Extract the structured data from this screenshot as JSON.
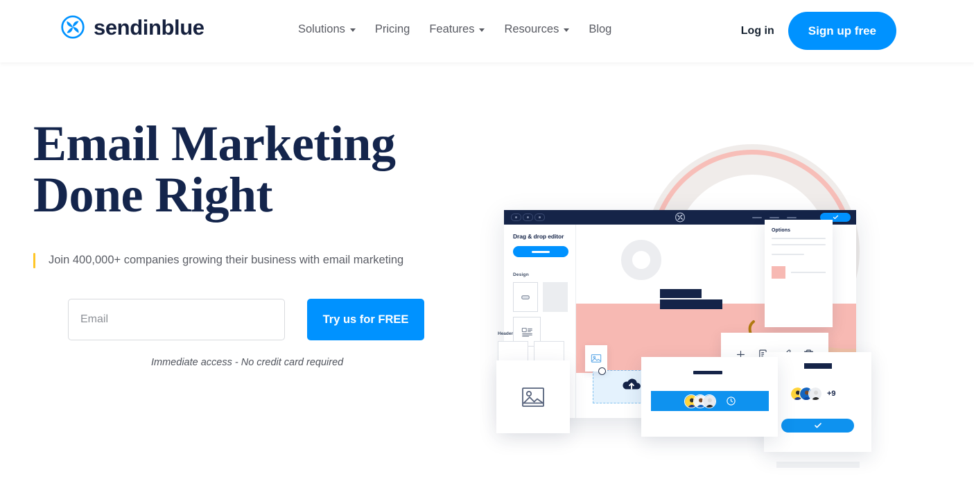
{
  "header": {
    "brand_name": "sendinblue",
    "logo_icon": "sendinblue-pinwheel-icon",
    "nav": [
      {
        "label": "Solutions",
        "has_dropdown": true
      },
      {
        "label": "Pricing",
        "has_dropdown": false
      },
      {
        "label": "Features",
        "has_dropdown": true
      },
      {
        "label": "Resources",
        "has_dropdown": true
      },
      {
        "label": "Blog",
        "has_dropdown": false
      }
    ],
    "login_label": "Log in",
    "signup_label": "Sign up free"
  },
  "hero": {
    "title": "Email Marketing Done Right",
    "subtitle": "Join 400,000+ companies growing their business with email marketing",
    "email_placeholder": "Email",
    "email_value": "",
    "cta_label": "Try us for FREE",
    "note": "Immediate access - No credit card required"
  },
  "illustration": {
    "editor": {
      "sidebar_title": "Drag & drop editor",
      "section_design": "Design",
      "section_header": "Header",
      "titlebar_logo": "sendinblue-pinwheel-icon",
      "confirm_icon": "check-icon"
    },
    "options_panel": {
      "title": "Options"
    },
    "toolbar_icons": [
      "plus-icon",
      "duplicate-icon",
      "pencil-icon",
      "trash-icon"
    ],
    "dropzone_icon": "cloud-upload-icon",
    "image_placeholder_icon": "image-icon",
    "schedule_icon": "clock-icon",
    "team_extra_count": "+9",
    "team_confirm_icon": "check-icon"
  },
  "colors": {
    "brand_blue": "#0092ff",
    "navy": "#152448",
    "heading_navy": "#14254c",
    "accent_yellow": "#ffc627",
    "pink": "#f7b9b3",
    "ring_gray": "#efebe9"
  }
}
